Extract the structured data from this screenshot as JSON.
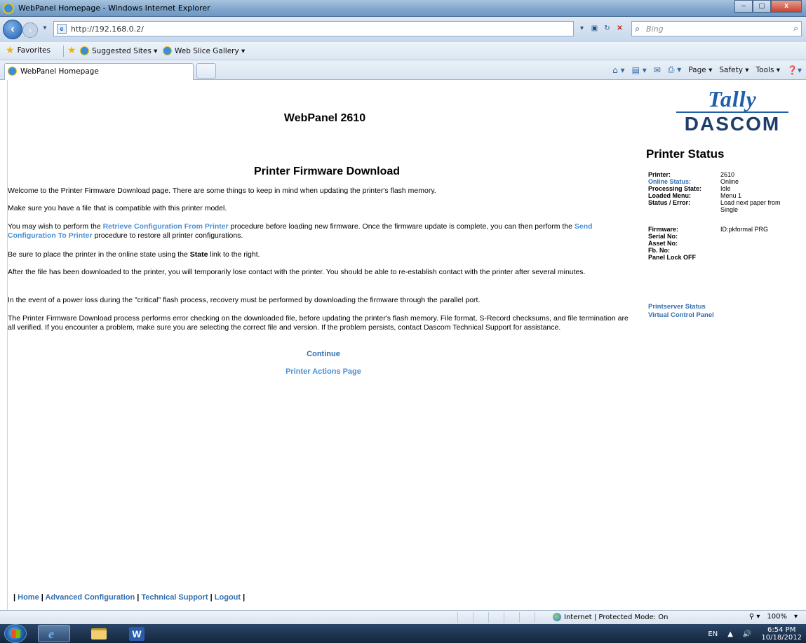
{
  "window": {
    "title": "WebPanel Homepage - Windows Internet Explorer",
    "minimize": "–",
    "maximize": "▢",
    "close": "x"
  },
  "browser": {
    "address": "http://192.168.0.2/",
    "search_placeholder": "Bing",
    "favorites_label": "Favorites",
    "suggested_sites": "Suggested Sites ▾",
    "web_slice_gallery": "Web Slice Gallery ▾",
    "tab_label": "WebPanel Homepage",
    "cmd_page": "Page ▾",
    "cmd_safety": "Safety ▾",
    "cmd_tools": "Tools ▾"
  },
  "page": {
    "title": "WebPanel 2610",
    "logo_top": "Tally",
    "logo_bottom": "DASCOM",
    "heading": "Printer Firmware Download",
    "p1": "Welcome to the Printer Firmware Download page. There are some things to keep in mind when updating the printer's flash memory.",
    "p2": "Make sure you have a file that is compatible with this printer model.",
    "p3_a": "You may wish to perform the ",
    "p3_link1": "Retrieve Configuration From Printer",
    "p3_b": " procedure before loading new firmware. Once the firmware update is complete, you can then perform the ",
    "p3_link2": "Send Configuration To Printer",
    "p3_c": " procedure to restore all printer configurations.",
    "p4_a": "Be sure to place the printer in the online state using the ",
    "p4_bold": "State",
    "p4_b": " link to the right.",
    "p5": "After the file has been downloaded to the printer, you will temporarily lose contact with the printer. You should be able to re-establish contact with the printer after several minutes.",
    "p6": "In the event of a power loss during the \"critical\" flash process, recovery must be performed by downloading the firmware through the parallel port.",
    "p7": "The Printer Firmware Download process performs error checking on the downloaded file, before updating the printer's flash memory. File format, S-Record checksums, and file termination are all verified. If you encounter a problem, make sure you are selecting the correct file and version. If the problem persists, contact Dascom Technical Support for assistance.",
    "continue": "Continue",
    "printer_actions": "Printer Actions Page"
  },
  "status": {
    "title": "Printer Status",
    "printer_label": "Printer:",
    "printer_value": "2610",
    "online_label": "Online Status:",
    "online_value": "Online",
    "processing_label": "Processing State:",
    "processing_value": "Idle",
    "menu_label": "Loaded Menu:",
    "menu_value": "Menu 1",
    "error_label": "Status / Error:",
    "error_value": "Load next paper from Single",
    "firmware_label": "Firmware:",
    "firmware_value": "ID:pkformal PRG",
    "serial_label": "Serial No:",
    "asset_label": "Asset No:",
    "fb_label": "Fb. No:",
    "panel_lock": "Panel Lock OFF",
    "printserver_link": "Printserver Status",
    "vcp_link": "Virtual Control Panel"
  },
  "footer": {
    "home": "Home",
    "advanced": "Advanced Configuration",
    "support": "Technical Support",
    "logout": "Logout"
  },
  "statusbar": {
    "zone": "Internet | Protected Mode: On",
    "zoom": "100%"
  },
  "taskbar": {
    "lang": "EN",
    "time": "6:54 PM",
    "date": "10/18/2012"
  }
}
